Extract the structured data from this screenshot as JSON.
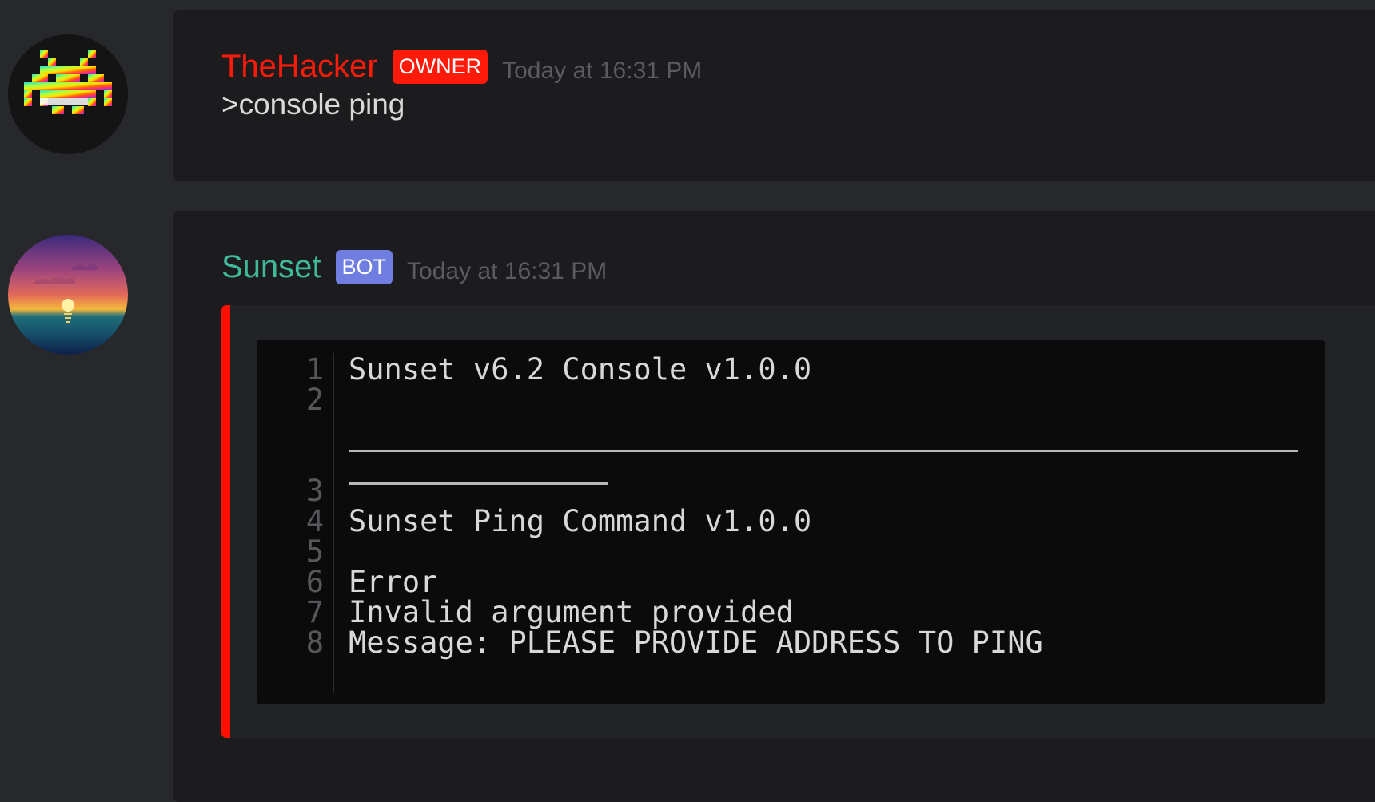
{
  "messages": [
    {
      "username": "TheHacker",
      "username_color": "#ff1a0a",
      "badge": "OWNER",
      "badge_color": "#ff1a0a",
      "timestamp": "Today at 16:31 PM",
      "content": ">console ping",
      "avatar_icon": "space-invader-rainbow-icon"
    },
    {
      "username": "Sunset",
      "username_color": "#3fb99a",
      "badge": "BOT",
      "badge_color": "#6f7ee0",
      "timestamp": "Today at 16:31 PM",
      "avatar_icon": "sunset-landscape-icon",
      "embed": {
        "accent_color": "#ff0f00",
        "code_lines": [
          {
            "number": "1",
            "text": "Sunset v6.2 Console v1.0.0"
          },
          {
            "number": "2",
            "text": ""
          },
          {
            "number": "3",
            "text": ""
          },
          {
            "number": "4",
            "text": "Sunset Ping Command v1.0.0"
          },
          {
            "number": "5",
            "text": ""
          },
          {
            "number": "6",
            "text": "Error"
          },
          {
            "number": "7",
            "text": "Invalid argument provided"
          },
          {
            "number": "8",
            "text": "Message: PLEASE PROVIDE ADDRESS TO PING"
          }
        ]
      }
    }
  ]
}
